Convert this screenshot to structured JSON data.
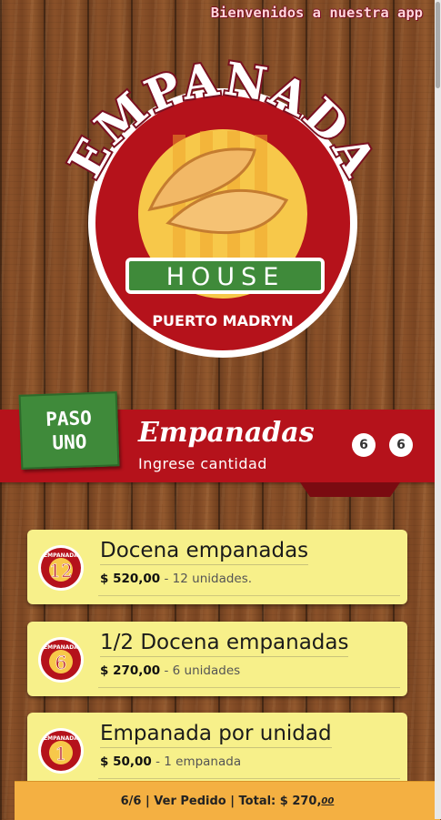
{
  "header": {
    "welcome": "Bienvenidos a nuestra app"
  },
  "logo": {
    "line1": "EMPANADA",
    "line2": "HOUSE",
    "line3": "PUERTO MADRYN"
  },
  "step": {
    "badge_line1": "PASO",
    "badge_line2": "UNO",
    "title": "Empanadas",
    "subtitle": "Ingrese cantidad",
    "counters": [
      "6",
      "6"
    ]
  },
  "products": [
    {
      "badge": "12",
      "name": "Docena empanadas",
      "price": "$ 520,00",
      "desc": "- 12 unidades."
    },
    {
      "badge": "6",
      "name": "1/2 Docena empanadas",
      "price": "$ 270,00",
      "desc": "- 6 unidades"
    },
    {
      "badge": "1",
      "name": "Empanada por unidad",
      "price": "$ 50,00",
      "desc": "- 1 empanada"
    }
  ],
  "footer": {
    "summary": "6/6 | Ver Pedido | Total: $ 270,",
    "cents": "00"
  },
  "colors": {
    "banner_red": "#b5121b",
    "badge_green": "#3f8a3a",
    "card_yellow": "#f7f08a",
    "footer_orange": "#f4b042"
  }
}
